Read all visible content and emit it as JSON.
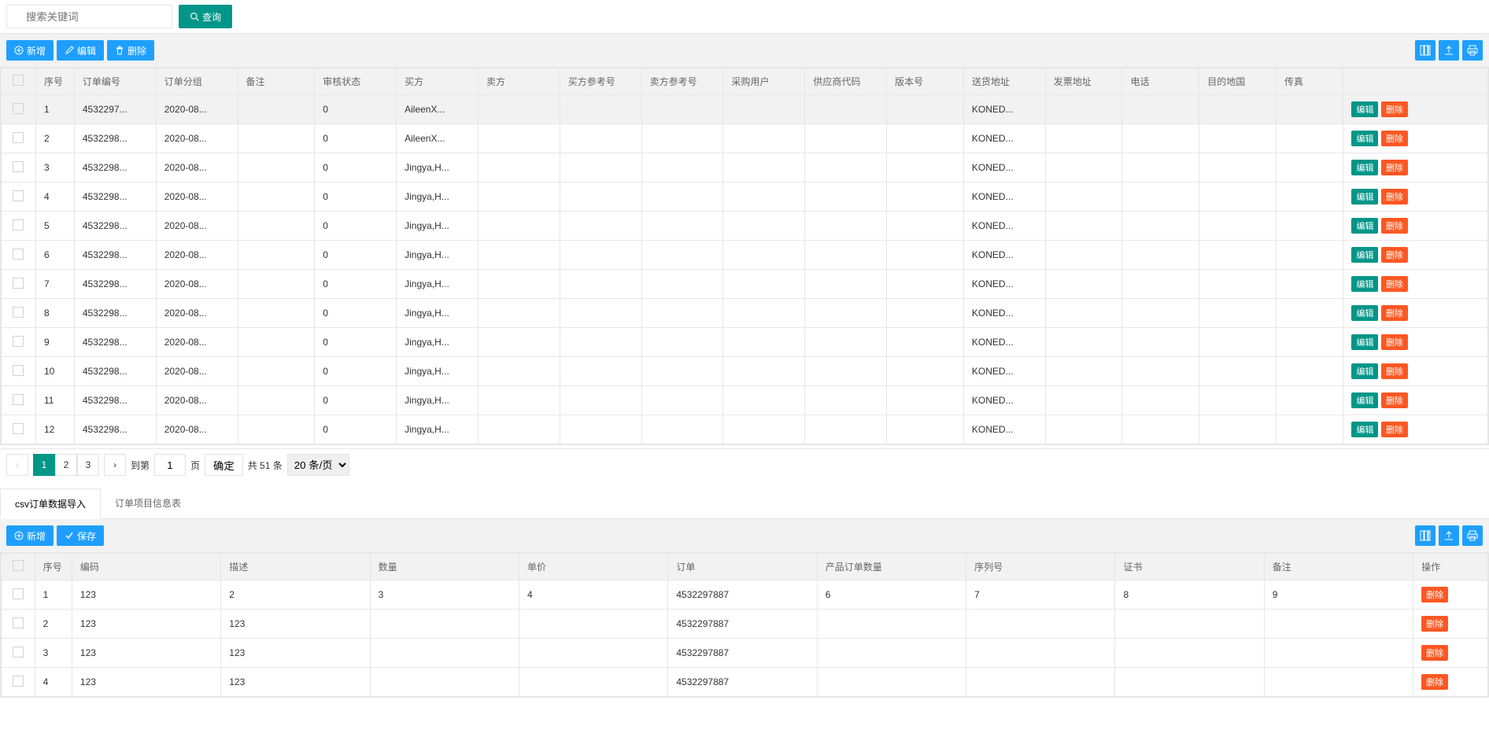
{
  "search": {
    "placeholder": "搜索关键词",
    "query_label": "查询"
  },
  "top_toolbar": {
    "add_label": "新增",
    "edit_label": "编辑",
    "delete_label": "删除"
  },
  "main_headers": [
    "序号",
    "订单编号",
    "订单分组",
    "备注",
    "审核状态",
    "买方",
    "卖方",
    "买方参考号",
    "卖方参考号",
    "采购用户",
    "供应商代码",
    "版本号",
    "送货地址",
    "发票地址",
    "电话",
    "目的地国",
    "传真"
  ],
  "main_rows": [
    {
      "idx": "1",
      "order": "4532297...",
      "group": "2020-08...",
      "remark": "",
      "audit": "0",
      "buyer": "AileenX...",
      "seller": "",
      "bref": "",
      "sref": "",
      "puser": "",
      "scode": "",
      "ver": "",
      "ship": "KONED...",
      "inv": "",
      "tel": "",
      "dest": "",
      "fax": ""
    },
    {
      "idx": "2",
      "order": "4532298...",
      "group": "2020-08...",
      "remark": "",
      "audit": "0",
      "buyer": "AileenX...",
      "seller": "",
      "bref": "",
      "sref": "",
      "puser": "",
      "scode": "",
      "ver": "",
      "ship": "KONED...",
      "inv": "",
      "tel": "",
      "dest": "",
      "fax": ""
    },
    {
      "idx": "3",
      "order": "4532298...",
      "group": "2020-08...",
      "remark": "",
      "audit": "0",
      "buyer": "Jingya,H...",
      "seller": "",
      "bref": "",
      "sref": "",
      "puser": "",
      "scode": "",
      "ver": "",
      "ship": "KONED...",
      "inv": "",
      "tel": "",
      "dest": "",
      "fax": ""
    },
    {
      "idx": "4",
      "order": "4532298...",
      "group": "2020-08...",
      "remark": "",
      "audit": "0",
      "buyer": "Jingya,H...",
      "seller": "",
      "bref": "",
      "sref": "",
      "puser": "",
      "scode": "",
      "ver": "",
      "ship": "KONED...",
      "inv": "",
      "tel": "",
      "dest": "",
      "fax": ""
    },
    {
      "idx": "5",
      "order": "4532298...",
      "group": "2020-08...",
      "remark": "",
      "audit": "0",
      "buyer": "Jingya,H...",
      "seller": "",
      "bref": "",
      "sref": "",
      "puser": "",
      "scode": "",
      "ver": "",
      "ship": "KONED...",
      "inv": "",
      "tel": "",
      "dest": "",
      "fax": ""
    },
    {
      "idx": "6",
      "order": "4532298...",
      "group": "2020-08...",
      "remark": "",
      "audit": "0",
      "buyer": "Jingya,H...",
      "seller": "",
      "bref": "",
      "sref": "",
      "puser": "",
      "scode": "",
      "ver": "",
      "ship": "KONED...",
      "inv": "",
      "tel": "",
      "dest": "",
      "fax": ""
    },
    {
      "idx": "7",
      "order": "4532298...",
      "group": "2020-08...",
      "remark": "",
      "audit": "0",
      "buyer": "Jingya,H...",
      "seller": "",
      "bref": "",
      "sref": "",
      "puser": "",
      "scode": "",
      "ver": "",
      "ship": "KONED...",
      "inv": "",
      "tel": "",
      "dest": "",
      "fax": ""
    },
    {
      "idx": "8",
      "order": "4532298...",
      "group": "2020-08...",
      "remark": "",
      "audit": "0",
      "buyer": "Jingya,H...",
      "seller": "",
      "bref": "",
      "sref": "",
      "puser": "",
      "scode": "",
      "ver": "",
      "ship": "KONED...",
      "inv": "",
      "tel": "",
      "dest": "",
      "fax": ""
    },
    {
      "idx": "9",
      "order": "4532298...",
      "group": "2020-08...",
      "remark": "",
      "audit": "0",
      "buyer": "Jingya,H...",
      "seller": "",
      "bref": "",
      "sref": "",
      "puser": "",
      "scode": "",
      "ver": "",
      "ship": "KONED...",
      "inv": "",
      "tel": "",
      "dest": "",
      "fax": ""
    },
    {
      "idx": "10",
      "order": "4532298...",
      "group": "2020-08...",
      "remark": "",
      "audit": "0",
      "buyer": "Jingya,H...",
      "seller": "",
      "bref": "",
      "sref": "",
      "puser": "",
      "scode": "",
      "ver": "",
      "ship": "KONED...",
      "inv": "",
      "tel": "",
      "dest": "",
      "fax": ""
    },
    {
      "idx": "11",
      "order": "4532298...",
      "group": "2020-08...",
      "remark": "",
      "audit": "0",
      "buyer": "Jingya,H...",
      "seller": "",
      "bref": "",
      "sref": "",
      "puser": "",
      "scode": "",
      "ver": "",
      "ship": "KONED...",
      "inv": "",
      "tel": "",
      "dest": "",
      "fax": ""
    },
    {
      "idx": "12",
      "order": "4532298...",
      "group": "2020-08...",
      "remark": "",
      "audit": "0",
      "buyer": "Jingya,H...",
      "seller": "",
      "bref": "",
      "sref": "",
      "puser": "",
      "scode": "",
      "ver": "",
      "ship": "KONED...",
      "inv": "",
      "tel": "",
      "dest": "",
      "fax": ""
    }
  ],
  "row_actions": {
    "edit": "编辑",
    "delete": "删除"
  },
  "pager": {
    "pages": [
      "1",
      "2",
      "3"
    ],
    "goto_label": "到第",
    "page_suffix": "页",
    "goto_value": "1",
    "confirm": "确定",
    "total": "共 51 条",
    "per_page": "20 条/页"
  },
  "tabs": {
    "t1": "csv订单数据导入",
    "t2": "订单项目信息表"
  },
  "sub_toolbar": {
    "add_label": "新增",
    "save_label": "保存"
  },
  "sub_headers": [
    "序号",
    "编码",
    "描述",
    "数量",
    "单价",
    "订单",
    "产品订单数量",
    "序列号",
    "证书",
    "备注",
    "操作"
  ],
  "sub_rows": [
    {
      "idx": "1",
      "code": "123",
      "desc": "2",
      "qty": "3",
      "price": "4",
      "order": "4532297887",
      "pqty": "6",
      "serial": "7",
      "cert": "8",
      "remark": "9"
    },
    {
      "idx": "2",
      "code": "123",
      "desc": "123",
      "qty": "",
      "price": "",
      "order": "4532297887",
      "pqty": "",
      "serial": "",
      "cert": "",
      "remark": ""
    },
    {
      "idx": "3",
      "code": "123",
      "desc": "123",
      "qty": "",
      "price": "",
      "order": "4532297887",
      "pqty": "",
      "serial": "",
      "cert": "",
      "remark": ""
    },
    {
      "idx": "4",
      "code": "123",
      "desc": "123",
      "qty": "",
      "price": "",
      "order": "4532297887",
      "pqty": "",
      "serial": "",
      "cert": "",
      "remark": ""
    }
  ],
  "sub_action_delete": "删除"
}
